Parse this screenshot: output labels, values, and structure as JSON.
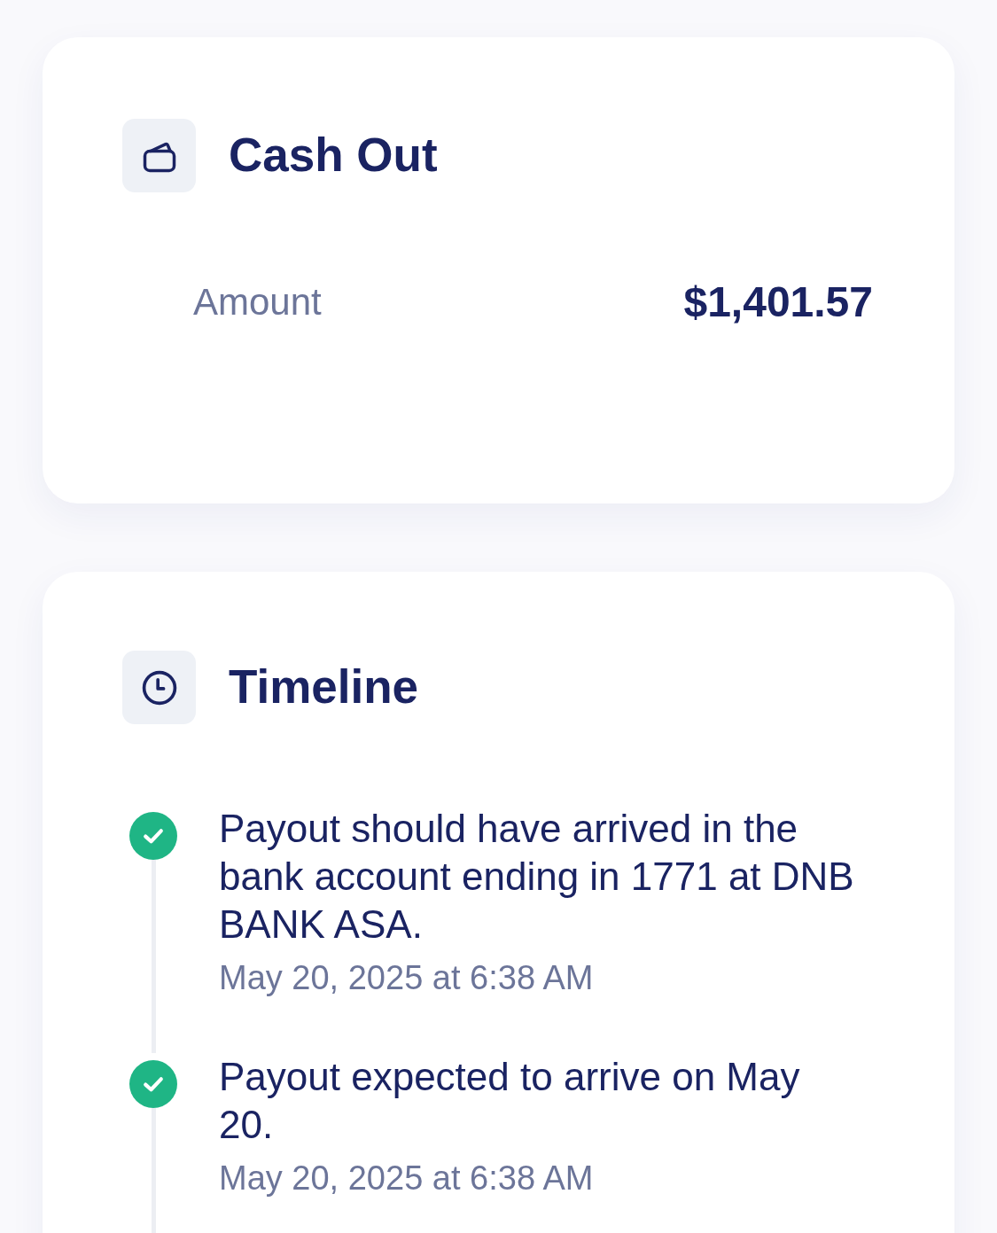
{
  "cash_out": {
    "title": "Cash Out",
    "amount": {
      "label": "Amount",
      "value": "$1,401.57"
    }
  },
  "timeline": {
    "title": "Timeline",
    "events": [
      {
        "text": "Payout should have arrived in the bank account ending in 1771 at DNB BANK ASA.",
        "time": "May 20, 2025 at 6:38 AM",
        "completed": true
      },
      {
        "text": "Payout expected to arrive on May 20.",
        "time": "May 20, 2025 at 6:38 AM",
        "completed": true
      }
    ]
  }
}
